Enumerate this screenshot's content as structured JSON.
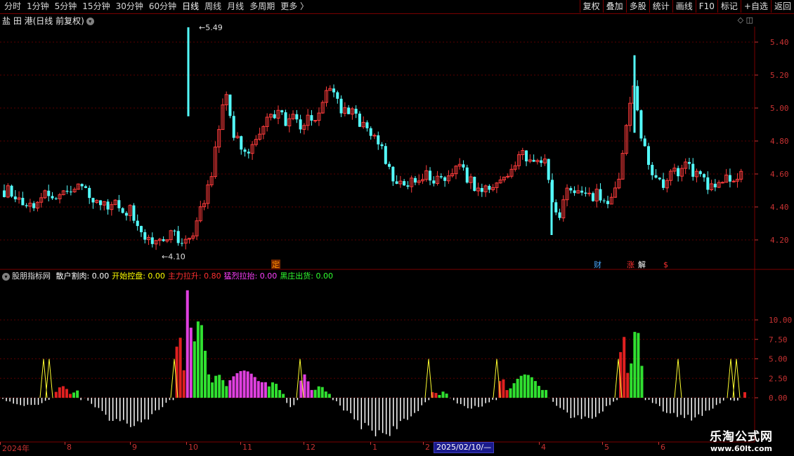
{
  "toolbar": {
    "periods": [
      "分时",
      "1分钟",
      "5分钟",
      "15分钟",
      "30分钟",
      "60分钟",
      "日线",
      "周线",
      "月线",
      "多周期",
      "更多 〉"
    ],
    "active": "日线",
    "right_buttons": [
      "复权",
      "叠加",
      "多股",
      "统计",
      "画线",
      "F10",
      "标记",
      "+自选",
      "返回"
    ]
  },
  "chart_header": {
    "title": "盐 田 港(日线 前复权)",
    "corner": "◇ ◫"
  },
  "price_axis": {
    "ticks": [
      "5.40",
      "5.20",
      "5.00",
      "4.80",
      "4.60",
      "4.40",
      "4.20"
    ],
    "high_marker": "5.49",
    "low_marker": "4.10"
  },
  "event_markers": [
    {
      "label": "定",
      "color": "#ff8c00"
    },
    {
      "label": "财",
      "color": "#4aa8ff"
    },
    {
      "label": "涨",
      "color": "#ff3030"
    },
    {
      "label": "解",
      "color": "#ffffff"
    },
    {
      "label": "$",
      "color": "#ff3030"
    }
  ],
  "indicator_legend": {
    "name": "股朋指标网",
    "items": [
      {
        "label": "散户割肉: 0.00",
        "color": "#ffffff"
      },
      {
        "label": "开始控盘: 0.00",
        "color": "#ffff00"
      },
      {
        "label": "主力拉升: 0.80",
        "color": "#ff3030"
      },
      {
        "label": "猛烈拉抬: 0.00",
        "color": "#ff40ff"
      },
      {
        "label": "黑庄出货: 0.00",
        "color": "#30ff30"
      }
    ]
  },
  "indicator_axis": {
    "ticks": [
      "10.00",
      "7.50",
      "5.00",
      "2.50",
      "0.00"
    ]
  },
  "date_axis": {
    "labels": [
      "2024年",
      "8",
      "9",
      "10",
      "11",
      "12",
      "1",
      "2",
      "4",
      "5",
      "6"
    ],
    "cursor": "2025/02/10/—"
  },
  "watermark": {
    "line1": "乐淘公式网",
    "line2": "www.60lt.com"
  },
  "chart_data": {
    "type": "candlestick",
    "symbol": "盐田港",
    "price_range": [
      4.1,
      5.49
    ],
    "close_path": [
      4.5,
      4.49,
      4.43,
      4.4,
      4.42,
      4.45,
      4.47,
      4.48,
      4.5,
      4.53,
      4.55,
      4.5,
      4.46,
      4.44,
      4.42,
      4.41,
      4.4,
      4.37,
      4.3,
      4.24,
      4.18,
      4.17,
      4.2,
      4.25,
      4.18,
      4.2,
      4.3,
      4.45,
      4.6,
      4.88,
      5.1,
      4.85,
      4.75,
      4.72,
      4.8,
      4.9,
      4.95,
      5.0,
      4.93,
      4.98,
      4.88,
      4.97,
      4.92,
      5.05,
      5.1,
      5.02,
      4.98,
      4.97,
      4.9,
      4.85,
      4.82,
      4.75,
      4.62,
      4.55,
      4.5,
      4.55,
      4.58,
      4.6,
      4.58,
      4.55,
      4.6,
      4.62,
      4.62,
      4.55,
      4.52,
      4.53,
      4.52,
      4.55,
      4.58,
      4.65,
      4.72,
      4.68,
      4.7,
      4.68,
      4.45,
      4.35,
      4.55,
      4.52,
      4.5,
      4.48,
      4.47,
      4.44,
      4.45,
      4.58,
      4.88,
      5.1,
      4.82,
      4.65,
      4.58,
      4.55,
      4.6,
      4.62,
      4.68,
      4.62,
      4.57,
      4.52,
      4.55,
      4.55,
      4.56,
      4.58,
      4.6
    ],
    "indicator": {
      "series": [
        "散户割肉",
        "开始控盘",
        "主力拉升",
        "猛烈拉抬",
        "黑庄出货"
      ],
      "ylim": [
        -4,
        13
      ]
    }
  }
}
